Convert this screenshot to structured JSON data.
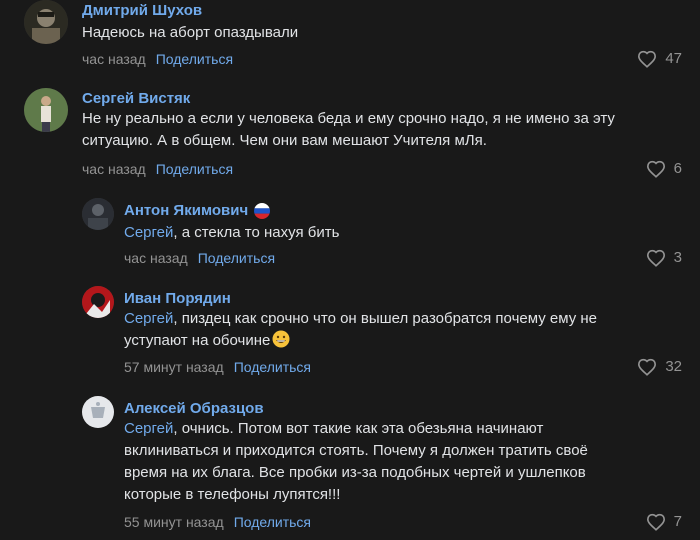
{
  "comments": [
    {
      "author": "Дмитрий Шухов",
      "text_lines": [
        "Надеюсь на аборт опаздывали"
      ],
      "time": "час назад",
      "share": "Поделиться",
      "likes": "47"
    },
    {
      "author": "Сергей Вистяк",
      "text_lines": [
        "Не ну реально а если у человека беда и ему срочно надо, я не имено за эту",
        "ситуацию. А в общем. Чем они вам мешают Учителя мЛя."
      ],
      "time": "час назад",
      "share": "Поделиться",
      "likes": "6"
    },
    {
      "author": "Антон Якимович",
      "mention": "Сергей",
      "text_lines": [
        ", а стекла то нахуя бить"
      ],
      "time": "час назад",
      "share": "Поделиться",
      "likes": "3"
    },
    {
      "author": "Иван Порядин",
      "mention": "Сергей",
      "text_lines": [
        ", пиздец как срочно что он вышел разобратся почему ему не",
        "уступают на обочине"
      ],
      "time": "57 минут назад",
      "share": "Поделиться",
      "likes": "32"
    },
    {
      "author": "Алексей Образцов",
      "mention": "Сергей",
      "text_lines": [
        ", очнись. Потом вот такие как эта обезьяна начинают",
        "вклиниваться и приходится стоять. Почему я должен тратить своё",
        "время на их блага. Все пробки из-за подобных чертей и ушлепков",
        "которые в телефоны лупятся!!!"
      ],
      "time": "55 минут назад",
      "share": "Поделиться",
      "likes": "7"
    }
  ],
  "colors": {
    "background": "#191919",
    "link": "#71aaeb",
    "text": "#e1e3e6",
    "muted": "#939393"
  }
}
